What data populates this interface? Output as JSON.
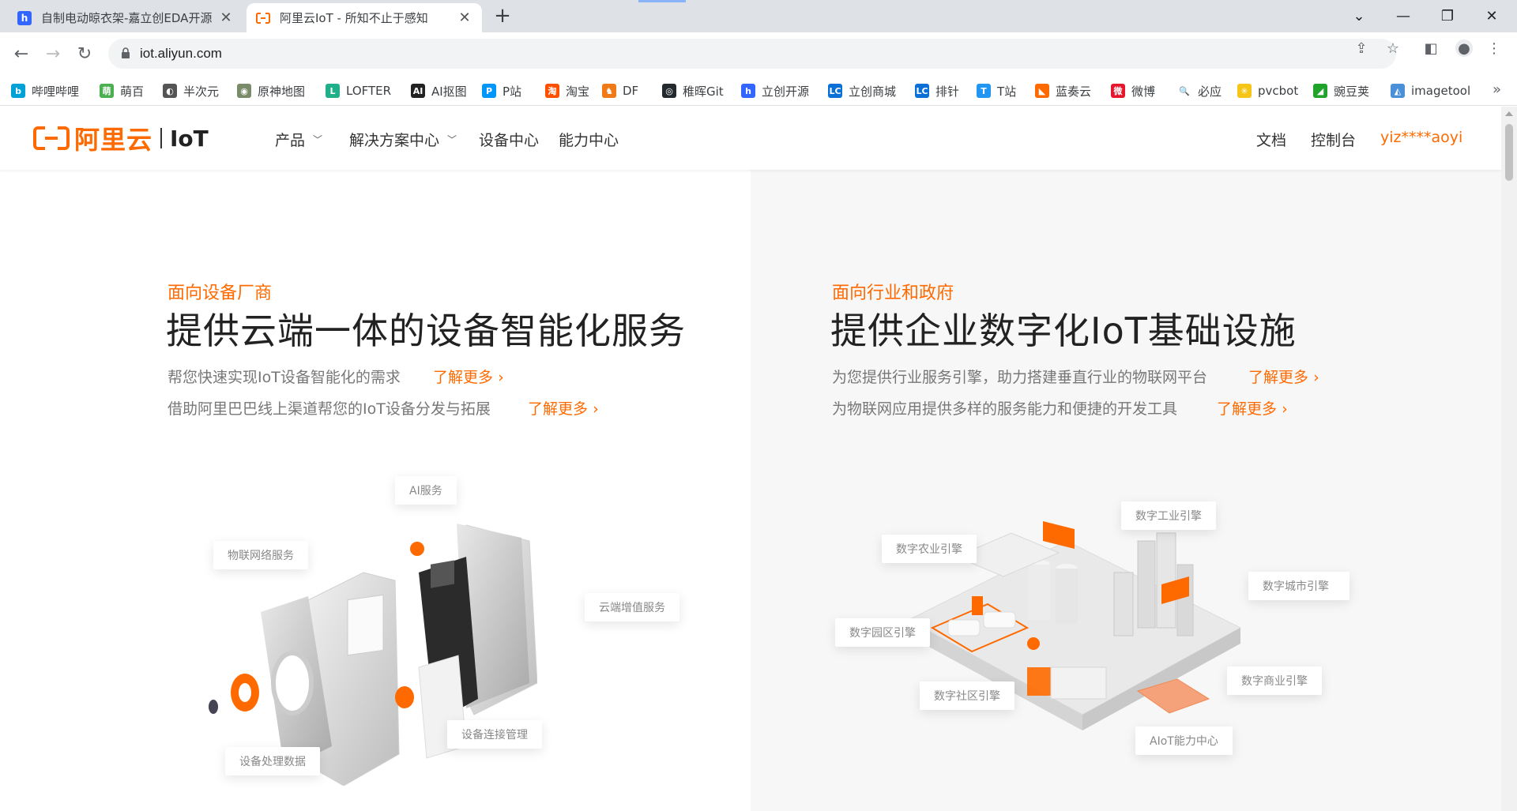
{
  "browser": {
    "tabs": [
      {
        "title": "自制电动晾衣架-嘉立创EDA开源",
        "favicon": "lceda-icon",
        "active": false
      },
      {
        "title": "阿里云IoT - 所知不止于感知",
        "favicon": "aliyun-icon",
        "active": true
      }
    ],
    "url": "iot.aliyun.com",
    "bookmarks": [
      {
        "label": "哔哩哔哩",
        "color": "#00a1d6",
        "glyph": "b"
      },
      {
        "label": "萌百",
        "color": "#4caf50",
        "glyph": "萌"
      },
      {
        "label": "半次元",
        "color": "#555555",
        "glyph": "◐"
      },
      {
        "label": "原神地图",
        "color": "#7a8b6a",
        "glyph": "◉"
      },
      {
        "label": "LOFTER",
        "color": "#1fb08a",
        "glyph": "L"
      },
      {
        "label": "AI抠图",
        "color": "#222222",
        "glyph": "AI"
      },
      {
        "label": "P站",
        "color": "#0096fa",
        "glyph": "P"
      },
      {
        "label": "淘宝",
        "color": "#ff5000",
        "glyph": "淘"
      },
      {
        "label": "DF",
        "color": "#f07a18",
        "glyph": "♞"
      },
      {
        "label": "稚晖Git",
        "color": "#24292e",
        "glyph": "◎"
      },
      {
        "label": "立创开源",
        "color": "#3366ff",
        "glyph": "h"
      },
      {
        "label": "立创商城",
        "color": "#0a6fd6",
        "glyph": "LC"
      },
      {
        "label": "排针",
        "color": "#0a6fd6",
        "glyph": "LC"
      },
      {
        "label": "T站",
        "color": "#2196f3",
        "glyph": "T"
      },
      {
        "label": "蓝奏云",
        "color": "#ff6a00",
        "glyph": "◣"
      },
      {
        "label": "微博",
        "color": "#e6162d",
        "glyph": "微"
      },
      {
        "label": "必应",
        "color": "#ffffff",
        "glyph": "🔍"
      },
      {
        "label": "pvcbot",
        "color": "#f5c518",
        "glyph": "✳"
      },
      {
        "label": "豌豆荚",
        "color": "#1fa32b",
        "glyph": "◢"
      },
      {
        "label": "imagetool",
        "color": "#4a90d9",
        "glyph": "◭"
      }
    ]
  },
  "site": {
    "brand": "阿里云",
    "product": "IoT",
    "nav": [
      {
        "label": "产品",
        "dropdown": true
      },
      {
        "label": "解决方案中心",
        "dropdown": true
      },
      {
        "label": "设备中心",
        "dropdown": false
      },
      {
        "label": "能力中心",
        "dropdown": false
      }
    ],
    "right_nav": {
      "docs": "文档",
      "console": "控制台",
      "user": "yiz****aoyi"
    },
    "accent": "#ff6a00"
  },
  "left": {
    "eyebrow": "面向设备厂商",
    "headline": "提供云端一体的设备智能化服务",
    "lines": [
      {
        "text": "帮您快速实现IoT设备智能化的需求",
        "link": "了解更多"
      },
      {
        "text": "借助阿里巴巴线上渠道帮您的IoT设备分发与拓展",
        "link": "了解更多"
      }
    ],
    "chips": [
      "AI服务",
      "物联网络服务",
      "云端增值服务",
      "设备连接管理",
      "设备处理数据"
    ]
  },
  "right": {
    "eyebrow": "面向行业和政府",
    "headline": "提供企业数字化IoT基础设施",
    "lines": [
      {
        "text": "为您提供行业服务引擎，助力搭建垂直行业的物联网平台",
        "link": "了解更多"
      },
      {
        "text": "为物联网应用提供多样的服务能力和便捷的开发工具",
        "link": "了解更多"
      }
    ],
    "chips": [
      "数字工业引擎",
      "数字农业引擎",
      "数字城市引擎",
      "数字园区引擎",
      "数字商业引擎",
      "数字社区引擎",
      "AIoT能力中心"
    ]
  }
}
